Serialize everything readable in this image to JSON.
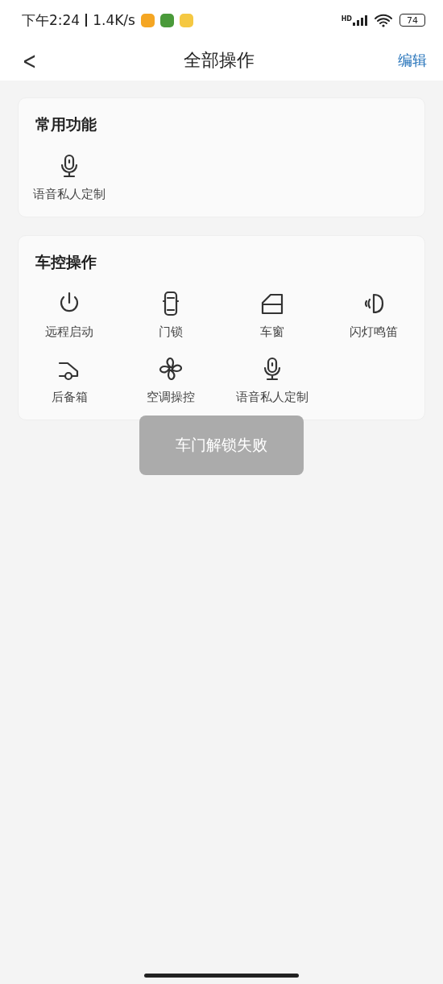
{
  "status_bar": {
    "time": "下午2:24",
    "speed": "1.4K/s",
    "network": "HD",
    "battery": "74"
  },
  "header": {
    "back": "<",
    "title": "全部操作",
    "action": "编辑"
  },
  "sections": [
    {
      "title": "常用功能",
      "items": [
        {
          "label": "语音私人定制",
          "kind": "mic"
        }
      ]
    },
    {
      "title": "车控操作",
      "items": [
        {
          "label": "远程启动",
          "kind": "power"
        },
        {
          "label": "门锁",
          "kind": "car"
        },
        {
          "label": "车窗",
          "kind": "window"
        },
        {
          "label": "闪灯鸣笛",
          "kind": "horn"
        },
        {
          "label": "后备箱",
          "kind": "trunk"
        },
        {
          "label": "空调操控",
          "kind": "fan"
        },
        {
          "label": "语音私人定制",
          "kind": "mic"
        }
      ]
    }
  ],
  "toast": "车门解锁失败"
}
